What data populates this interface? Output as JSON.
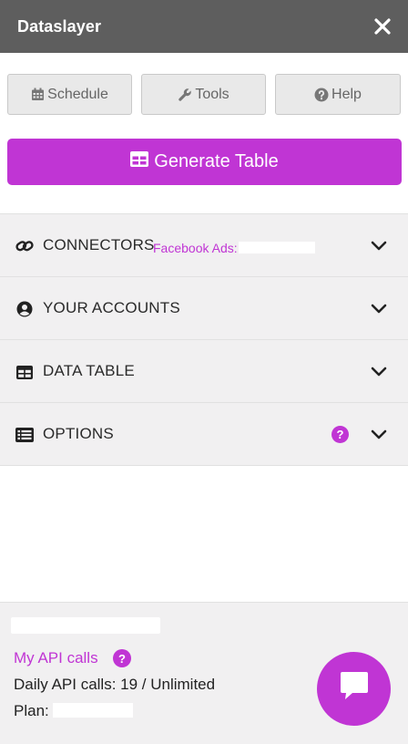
{
  "header": {
    "title": "Dataslayer"
  },
  "toolbar": {
    "schedule_label": "Schedule",
    "tools_label": "Tools",
    "help_label": "Help"
  },
  "generate": {
    "label": "Generate Table"
  },
  "sections": [
    {
      "label": "CONNECTORS",
      "subtitle": "Facebook Ads:"
    },
    {
      "label": "YOUR ACCOUNTS"
    },
    {
      "label": "DATA TABLE"
    },
    {
      "label": "OPTIONS",
      "help": "?"
    }
  ],
  "footer": {
    "api_link": "My API calls",
    "api_help": "?",
    "daily_calls": "Daily API calls: 19 / Unlimited",
    "plan_label": "Plan:"
  },
  "colors": {
    "accent": "#c035d4",
    "header": "#5e5e5e",
    "section_bg": "#f1f0f1"
  },
  "icons": {
    "close": "close-icon",
    "schedule": "calendar-icon",
    "tools": "wrench-icon",
    "help": "question-circle-icon",
    "generate": "table-icon",
    "connectors": "link-icon",
    "accounts": "user-circle-icon",
    "data_table": "table-icon",
    "options": "list-icon",
    "chat": "chat-icon"
  }
}
